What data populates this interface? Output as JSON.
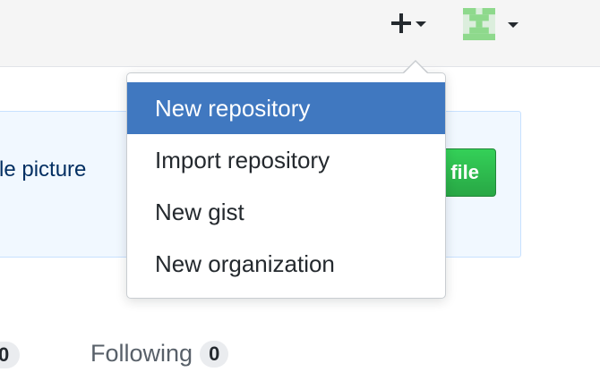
{
  "header": {
    "create_menu_icon": "plus-icon",
    "avatar_icon": "identicon"
  },
  "dropdown": {
    "items": [
      {
        "label": "New repository",
        "active": true
      },
      {
        "label": "Import repository",
        "active": false
      },
      {
        "label": "New gist",
        "active": false
      },
      {
        "label": "New organization",
        "active": false
      }
    ]
  },
  "notice": {
    "text": "file picture",
    "button_label": "file"
  },
  "profile_stats": {
    "followers_count": "0",
    "following_label": "Following",
    "following_count": "0"
  },
  "colors": {
    "menu_active": "#4078c0",
    "button_green": "#28a745",
    "notice_bg": "#f1f8ff"
  }
}
